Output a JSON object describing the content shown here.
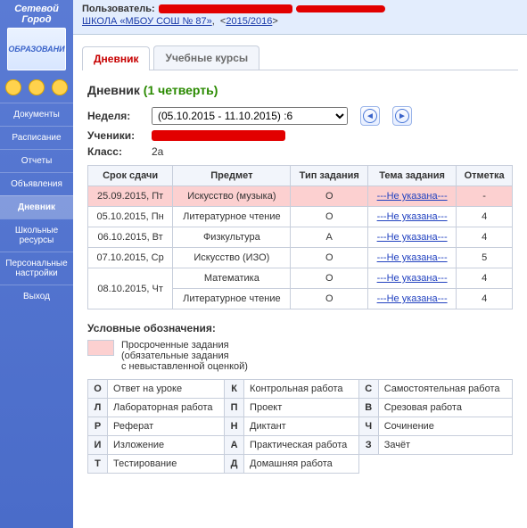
{
  "sidebar": {
    "logo_top": "Сетевой Город",
    "logo_badge": "ОБРАЗОВАНИ",
    "items": [
      {
        "label": "Документы"
      },
      {
        "label": "Расписание"
      },
      {
        "label": "Отчеты"
      },
      {
        "label": "Объявления"
      },
      {
        "label": "Дневник",
        "active": true
      },
      {
        "label": "Школьные ресурсы"
      },
      {
        "label": "Персональные настройки"
      },
      {
        "label": "Выход"
      }
    ]
  },
  "header": {
    "user_label": "Пользователь:",
    "school_link": "ШКОЛА «МБОУ СОШ № 87»",
    "year_link": "2015/2016"
  },
  "tabs": [
    {
      "label": "Дневник",
      "active": true
    },
    {
      "label": "Учебные курсы"
    }
  ],
  "diary": {
    "title": "Дневник",
    "quarter": "(1 четверть)",
    "week_label": "Неделя:",
    "week_option": "(05.10.2015 - 11.10.2015) :6",
    "student_label": "Ученики:",
    "class_label": "Класс:",
    "class_value": "2а",
    "columns": {
      "due": "Срок сдачи",
      "subject": "Предмет",
      "type": "Тип задания",
      "topic": "Тема задания",
      "mark": "Отметка"
    },
    "rows": [
      {
        "overdue": true,
        "due": "25.09.2015, Пт",
        "subject": "Искусство (музыка)",
        "type": "О",
        "topic": "---Не указана---",
        "mark": "-"
      },
      {
        "overdue": false,
        "due": "05.10.2015, Пн",
        "subject": "Литературное чтение",
        "type": "О",
        "topic": "---Не указана---",
        "mark": "4"
      },
      {
        "overdue": false,
        "due": "06.10.2015, Вт",
        "subject": "Физкультура",
        "type": "А",
        "topic": "---Не указана---",
        "mark": "4"
      },
      {
        "overdue": false,
        "due": "07.10.2015, Ср",
        "subject": "Искусство (ИЗО)",
        "type": "О",
        "topic": "---Не указана---",
        "mark": "5"
      },
      {
        "overdue": false,
        "due": "08.10.2015, Чт",
        "subject": "Математика",
        "type": "О",
        "topic": "---Не указана---",
        "mark": "4",
        "rowspan": 2
      },
      {
        "overdue": false,
        "due": "",
        "subject": "Литературное чтение",
        "type": "О",
        "topic": "---Не указана---",
        "mark": "4"
      }
    ]
  },
  "legend": {
    "title": "Условные обозначения:",
    "overdue_l1": "Просроченные задания",
    "overdue_l2": "(обязательные задания",
    "overdue_l3": "с невыставленной оценкой)",
    "codes": [
      [
        {
          "c": "О",
          "t": "Ответ на уроке"
        },
        {
          "c": "К",
          "t": "Контрольная работа"
        },
        {
          "c": "С",
          "t": "Самостоятельная работа"
        }
      ],
      [
        {
          "c": "Л",
          "t": "Лабораторная работа"
        },
        {
          "c": "П",
          "t": "Проект"
        },
        {
          "c": "В",
          "t": "Срезовая работа"
        }
      ],
      [
        {
          "c": "Р",
          "t": "Реферат"
        },
        {
          "c": "Н",
          "t": "Диктант"
        },
        {
          "c": "Ч",
          "t": "Сочинение"
        }
      ],
      [
        {
          "c": "И",
          "t": "Изложение"
        },
        {
          "c": "А",
          "t": "Практическая работа"
        },
        {
          "c": "З",
          "t": "Зачёт"
        }
      ],
      [
        {
          "c": "Т",
          "t": "Тестирование"
        },
        {
          "c": "Д",
          "t": "Домашняя работа"
        }
      ]
    ]
  }
}
